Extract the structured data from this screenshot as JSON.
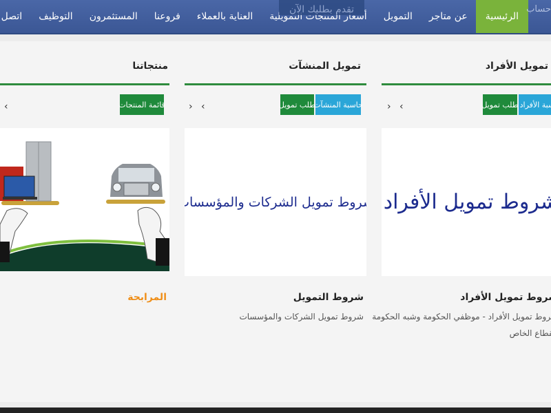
{
  "nav": {
    "items": [
      {
        "label": "الرئيسية",
        "active": true
      },
      {
        "label": "عن متاجر",
        "active": false
      },
      {
        "label": "التمويل",
        "active": false
      },
      {
        "label": "أسعار المنتجات التمويلية",
        "active": false
      },
      {
        "label": "العناية بالعملاء",
        "active": false
      },
      {
        "label": "فروعنا",
        "active": false
      },
      {
        "label": "المستثمرون",
        "active": false
      },
      {
        "label": "التوظيف",
        "active": false
      },
      {
        "label": "اتصل بنا",
        "active": false
      }
    ],
    "overlay_text": "تقدم بطلبك الآن",
    "edge_text": "حساب"
  },
  "sections": {
    "individuals": {
      "title": "تمويل الأفراد",
      "buttons": [
        "حاسبة الأفراد",
        "طلب تمويل"
      ],
      "banner_text": "شروط تمويل الأفراد",
      "item_title": "شروط تمويل الأفراد",
      "item_desc_line1": "شروط تمويل الأفراد - موظفي الحكومة وشبه الحكومة",
      "item_desc_line2": "القطاع الخاص"
    },
    "enterprises": {
      "title": "تمويل المنشآت",
      "buttons": [
        "حاسبة المنشآت",
        "طلب تمويل"
      ],
      "banner_text": "شروط تمويل الشركات والمؤسسات",
      "item_title": "شروط التمويل",
      "item_desc": "شروط تمويل الشركات والمؤسسات"
    },
    "products": {
      "title": "منتجاتنا",
      "buttons": [
        "قائمة المنتجات"
      ],
      "item_title": "المرابحة"
    }
  },
  "arrows": {
    "prev": "‹",
    "next": "›"
  },
  "colors": {
    "nav_bg": "#3b5795",
    "nav_active": "#7ab33b",
    "accent_green": "#1f8a3b",
    "accent_blue": "#2aa6d8",
    "banner_text": "#1c2b8e",
    "highlight_orange": "#ef8f1a"
  }
}
